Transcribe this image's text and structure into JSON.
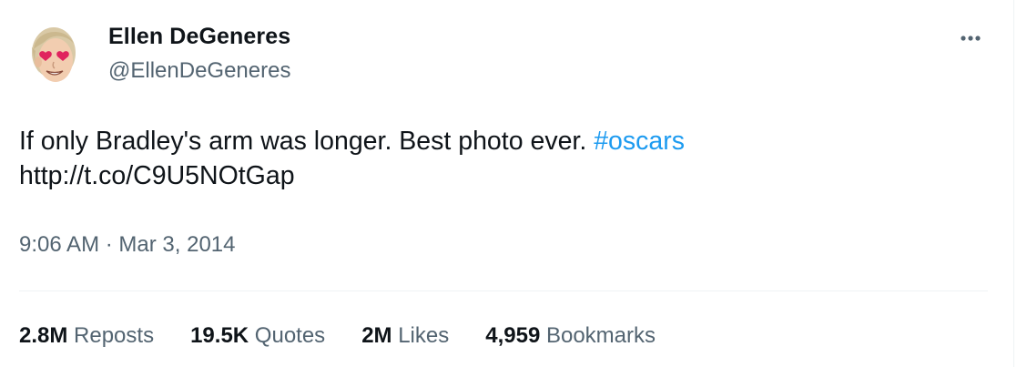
{
  "author": {
    "display_name": "Ellen DeGeneres",
    "handle": "@EllenDeGeneres",
    "avatar_icon": "cartoon-face-heart-eyes-icon"
  },
  "more_icon": "more-horizontal-icon",
  "tweet": {
    "text_line1": "If only Bradley's arm was longer. Best photo ever.",
    "hashtag": "#oscars",
    "link": "http://t.co/C9U5NOtGap"
  },
  "meta": {
    "time": "9:06 AM",
    "separator": "·",
    "date": "Mar 3, 2014"
  },
  "stats": [
    {
      "value": "2.8M",
      "label": "Reposts"
    },
    {
      "value": "19.5K",
      "label": "Quotes"
    },
    {
      "value": "2M",
      "label": "Likes"
    },
    {
      "value": "4,959",
      "label": "Bookmarks"
    }
  ],
  "colors": {
    "accent": "#1d9bf0",
    "secondary_text": "#536471",
    "primary_text": "#0f1419",
    "divider": "#eff3f4"
  }
}
